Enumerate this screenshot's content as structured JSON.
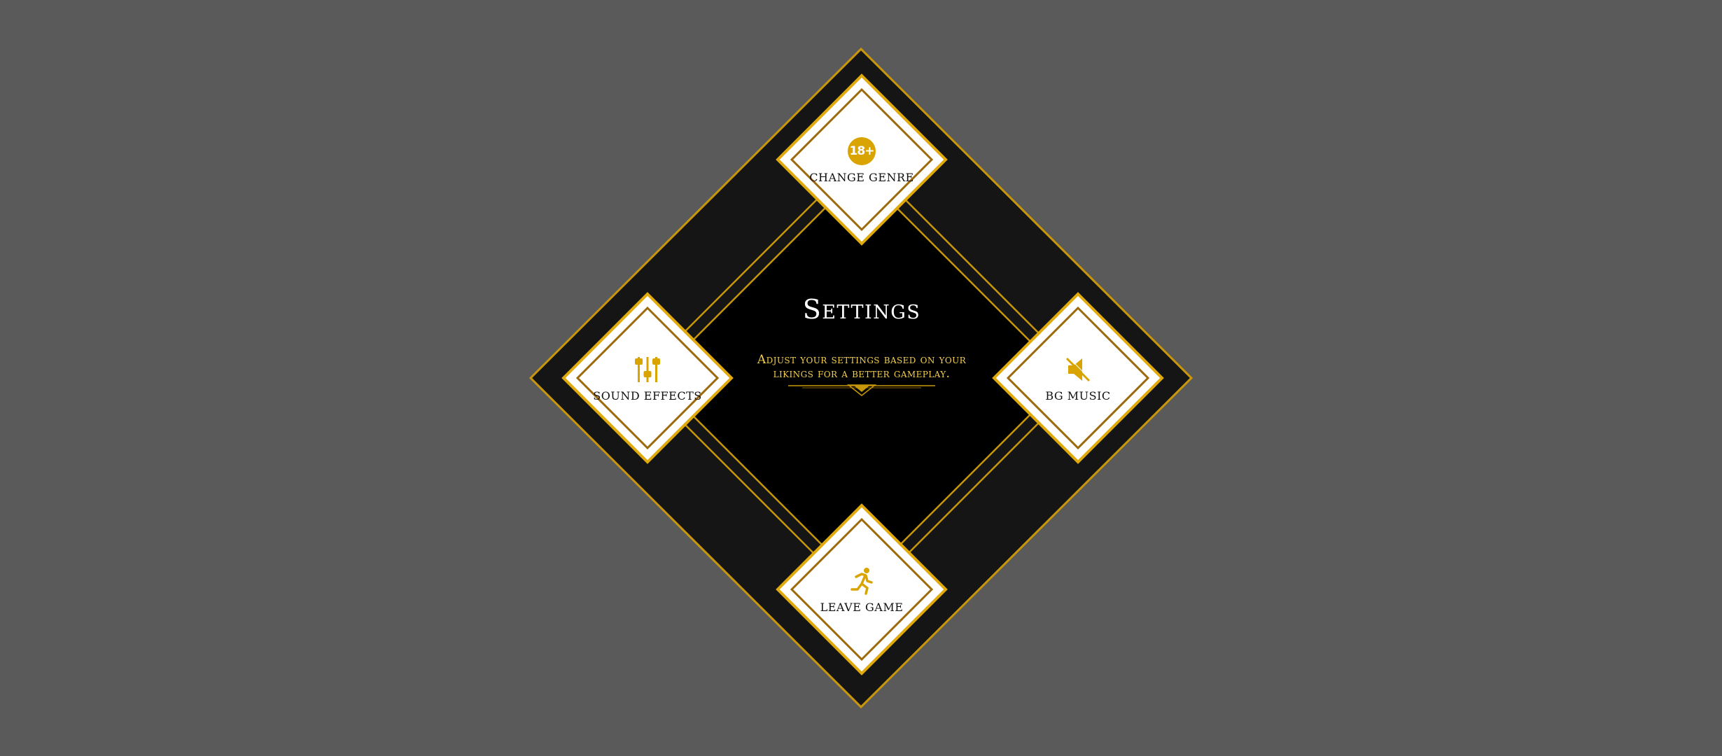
{
  "panel": {
    "title": "Settings",
    "subtitle_line1": "Adjust your settings based on your",
    "subtitle_line2": "likings for a better gameplay."
  },
  "tiles": {
    "change_genre": {
      "label": "CHANGE GENRE",
      "icon": "adult-18-plus-icon",
      "badge_text": "18+"
    },
    "sound_effects": {
      "label": "SOUND EFFECTS",
      "icon": "equalizer-sliders-icon"
    },
    "bg_music": {
      "label": "BG MUSIC",
      "icon": "speaker-muted-icon"
    },
    "leave_game": {
      "label": "LEAVE GAME",
      "icon": "running-person-exit-icon"
    }
  },
  "colors": {
    "background": "#5a5a5a",
    "frame_outer": "#1a1a1a",
    "frame_inner": "#000000",
    "gold": "#d9a400",
    "gold_dark": "#a8770a",
    "title": "#ffffff",
    "subtitle": "#f5cf4e",
    "tile_fill": "#ffffff"
  }
}
